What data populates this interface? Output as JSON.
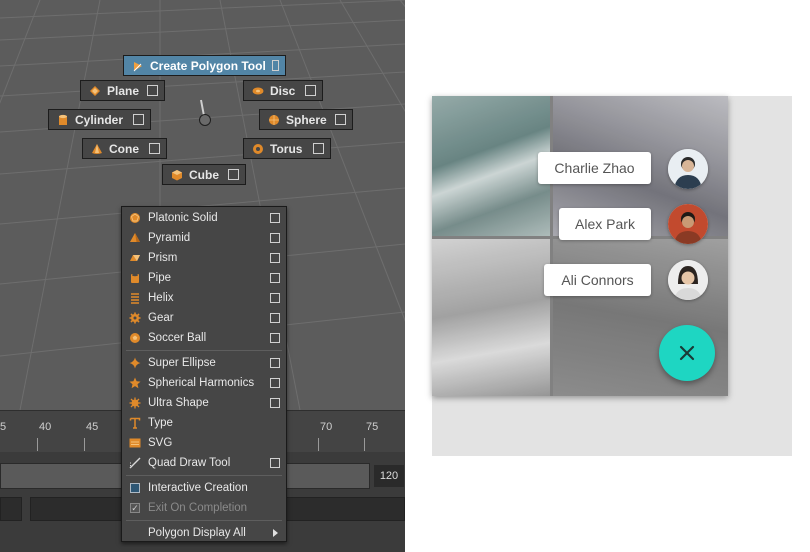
{
  "marking_menu": {
    "create_polygon_tool": "Create Polygon Tool",
    "plane": "Plane",
    "disc": "Disc",
    "cylinder": "Cylinder",
    "sphere": "Sphere",
    "cone": "Cone",
    "torus": "Torus",
    "cube": "Cube"
  },
  "timeline": {
    "ticks": [
      "5",
      "40",
      "45",
      "70",
      "75"
    ],
    "range_end": "120"
  },
  "menu": {
    "platonic_solid": "Platonic Solid",
    "pyramid": "Pyramid",
    "prism": "Prism",
    "pipe": "Pipe",
    "helix": "Helix",
    "gear": "Gear",
    "soccer_ball": "Soccer Ball",
    "super_ellipse": "Super Ellipse",
    "spherical_harmonics": "Spherical Harmonics",
    "ultra_shape": "Ultra Shape",
    "type": "Type",
    "svg": "SVG",
    "quad_draw_tool": "Quad Draw Tool",
    "interactive_creation": "Interactive Creation",
    "exit_on_completion": "Exit On Completion",
    "polygon_display_all": "Polygon Display All"
  },
  "colors": {
    "viewport_bg": "#5c5c5c",
    "highlight": "#5285a6",
    "icon_orange": "#e08a2a",
    "fab": "#1ed6c2"
  },
  "icons": {
    "fab_close": "close-icon",
    "submenu": "chevron-right-icon"
  },
  "speed_dial": {
    "contacts": [
      {
        "name": "Charlie Zhao"
      },
      {
        "name": "Alex Park"
      },
      {
        "name": "Ali Connors"
      }
    ]
  }
}
